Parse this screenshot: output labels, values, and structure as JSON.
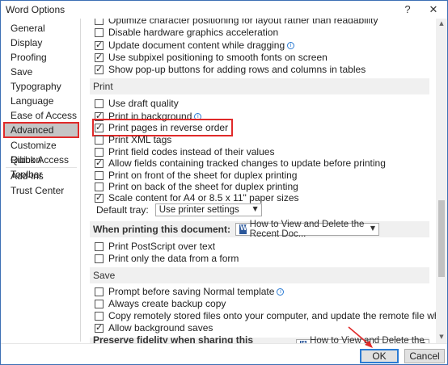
{
  "window": {
    "title": "Word Options",
    "help_label": "?",
    "close_label": "✕"
  },
  "sidebar": {
    "items": [
      {
        "label": "General"
      },
      {
        "label": "Display"
      },
      {
        "label": "Proofing"
      },
      {
        "label": "Save"
      },
      {
        "label": "Typography"
      },
      {
        "label": "Language"
      },
      {
        "label": "Ease of Access"
      },
      {
        "label": "Advanced",
        "active": true
      },
      {
        "label": "Customize Ribbon"
      },
      {
        "label": "Quick Access Toolbar"
      },
      {
        "label": "Add-ins"
      },
      {
        "label": "Trust Center"
      }
    ]
  },
  "display_options": [
    {
      "label": "Optimize character positioning for layout rather than readability",
      "checked": false
    },
    {
      "label": "Disable hardware graphics acceleration",
      "checked": false
    },
    {
      "label": "Update document content while dragging",
      "checked": true,
      "info": true
    },
    {
      "label": "Use subpixel positioning to smooth fonts on screen",
      "checked": true
    },
    {
      "label": "Show pop-up buttons for adding rows and columns in tables",
      "checked": true
    }
  ],
  "print_section": {
    "title": "Print",
    "options": [
      {
        "label": "Use draft quality",
        "checked": false
      },
      {
        "label": "Print in background",
        "checked": true,
        "info": true
      },
      {
        "label": "Print pages in reverse order",
        "checked": true,
        "highlighted": true
      },
      {
        "label": "Print XML tags",
        "checked": false
      },
      {
        "label": "Print field codes instead of their values",
        "checked": false
      },
      {
        "label": "Allow fields containing tracked changes to update before printing",
        "checked": true
      },
      {
        "label": "Print on front of the sheet for duplex printing",
        "checked": false
      },
      {
        "label": "Print on back of the sheet for duplex printing",
        "checked": false
      },
      {
        "label": "Scale content for A4 or 8.5 x 11\" paper sizes",
        "checked": true
      }
    ],
    "default_tray_label": "Default tray:",
    "default_tray_value": "Use printer settings"
  },
  "when_printing": {
    "title": "When printing this document:",
    "document": "How to View and Delete the Recent Doc...",
    "options": [
      {
        "label": "Print PostScript over text",
        "checked": false
      },
      {
        "label": "Print only the data from a form",
        "checked": false
      }
    ]
  },
  "save_section": {
    "title": "Save",
    "options": [
      {
        "label": "Prompt before saving Normal template",
        "checked": false,
        "info": true
      },
      {
        "label": "Always create backup copy",
        "checked": false
      },
      {
        "label": "Copy remotely stored files onto your computer, and update the remote file when saving",
        "checked": false
      },
      {
        "label": "Allow background saves",
        "checked": true
      }
    ]
  },
  "preserve_fidelity": {
    "title": "Preserve fidelity when sharing this document:",
    "document": "How to View and Delete the Recent Doc..."
  },
  "footer": {
    "ok_label": "OK",
    "cancel_label": "Cancel"
  },
  "colors": {
    "highlight": "#e02a2a",
    "accent": "#2b7bd3"
  }
}
